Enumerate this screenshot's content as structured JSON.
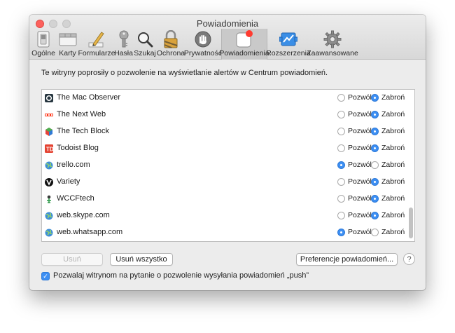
{
  "window": {
    "title": "Powiadomienia"
  },
  "toolbar": {
    "items": [
      {
        "label": "Ogólne",
        "icon": "switch-icon"
      },
      {
        "label": "Karty",
        "icon": "tabs-icon"
      },
      {
        "label": "Formularze",
        "icon": "pencil-icon"
      },
      {
        "label": "Hasła",
        "icon": "key-icon"
      },
      {
        "label": "Szukaj",
        "icon": "magnifier-icon"
      },
      {
        "label": "Ochrona",
        "icon": "lock-icon"
      },
      {
        "label": "Prywatność",
        "icon": "hand-icon"
      },
      {
        "label": "Powiadomienia",
        "icon": "notification-icon"
      },
      {
        "label": "Rozszerzenia",
        "icon": "puzzle-icon"
      },
      {
        "label": "Zaawansowane",
        "icon": "gear-icon"
      }
    ],
    "active": "Powiadomienia"
  },
  "main": {
    "intro": "Te witryny poprosiły o pozwolenie na wyświetlanie alertów w Centrum powiadomień.",
    "allow_label": "Pozwól",
    "deny_label": "Zabroń",
    "sites": [
      {
        "name": "The Mac Observer",
        "icon": "mac-observer-icon",
        "choice": "deny"
      },
      {
        "name": "The Next Web",
        "icon": "tnw-icon",
        "choice": "deny"
      },
      {
        "name": "The Tech Block",
        "icon": "tech-block-icon",
        "choice": "deny"
      },
      {
        "name": "Todoist Blog",
        "icon": "todoist-icon",
        "choice": "deny"
      },
      {
        "name": "trello.com",
        "icon": "globe-icon",
        "choice": "allow"
      },
      {
        "name": "Variety",
        "icon": "variety-icon",
        "choice": "deny"
      },
      {
        "name": "WCCFtech",
        "icon": "wccftech-icon",
        "choice": "deny"
      },
      {
        "name": "web.skype.com",
        "icon": "globe-icon",
        "choice": "deny"
      },
      {
        "name": "web.whatsapp.com",
        "icon": "globe-icon",
        "choice": "allow"
      }
    ],
    "buttons": {
      "remove": "Usuń",
      "remove_all": "Usuń wszystko",
      "preferences": "Preferencje powiadomień...",
      "help": "?"
    },
    "push_checkbox": {
      "label": "Pozwalaj witrynom na pytanie o pozwolenie wysyłania powiadomień „push”",
      "checked": true
    }
  },
  "colors": {
    "accent": "#3d8ff3",
    "close": "#fc605c",
    "badge": "#ff3b30"
  }
}
